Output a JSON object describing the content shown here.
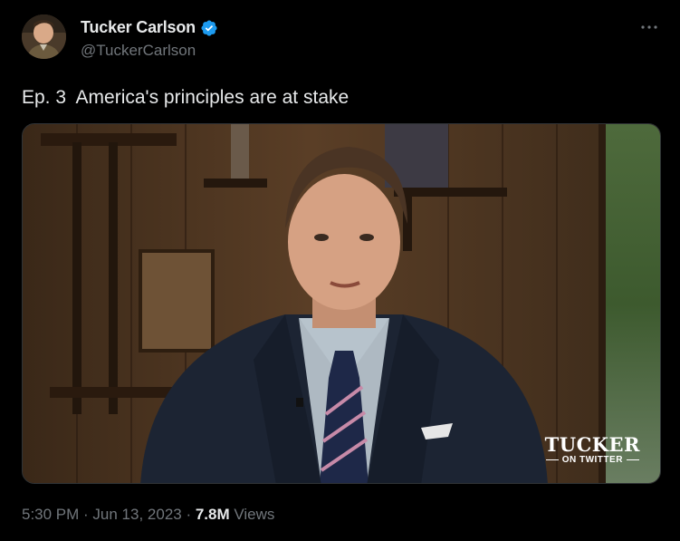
{
  "author": {
    "display_name": "Tucker Carlson",
    "handle": "@TuckerCarlson",
    "verified": true,
    "verified_color": "#1d9bf0"
  },
  "tweet": {
    "text": "Ep. 3  America's principles are at stake"
  },
  "media": {
    "type": "video",
    "watermark_line1": "TUCKER",
    "watermark_line2": "ON TWITTER"
  },
  "meta": {
    "time": "5:30 PM",
    "separator1": " · ",
    "date": "Jun 13, 2023",
    "separator2": " · ",
    "views_count": "7.8M",
    "views_label": " Views"
  },
  "icons": {
    "more": "more-dots-icon",
    "verified": "verified-badge-icon"
  },
  "colors": {
    "background": "#000000",
    "primary_text": "#e7e9ea",
    "secondary_text": "#71767b"
  }
}
